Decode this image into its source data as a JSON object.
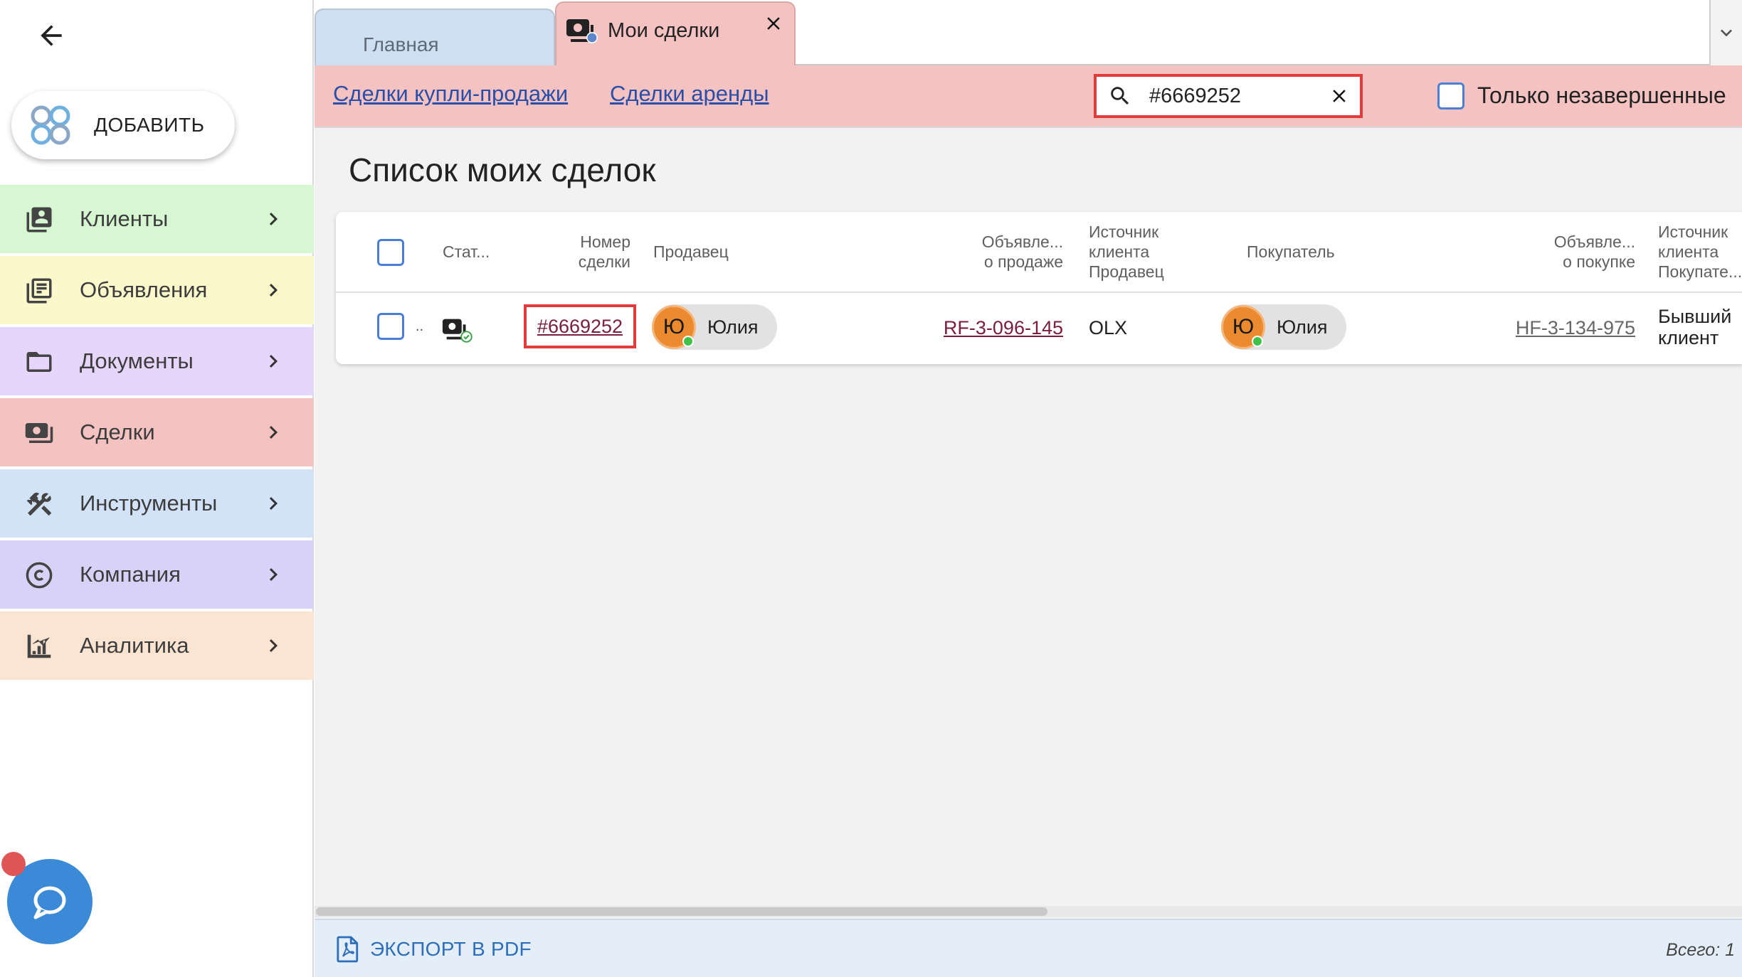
{
  "sidebar": {
    "add_label": "ДОБАВИТЬ",
    "items": [
      {
        "label": "Клиенты",
        "color": "#d6f7d2",
        "icon": "contacts-icon"
      },
      {
        "label": "Объявления",
        "color": "#fbf8cc",
        "icon": "listings-icon"
      },
      {
        "label": "Документы",
        "color": "#e6d6fb",
        "icon": "folder-icon"
      },
      {
        "label": "Сделки",
        "color": "#f5c2c2",
        "icon": "money-icon"
      },
      {
        "label": "Инструменты",
        "color": "#d2e2f7",
        "icon": "tools-icon"
      },
      {
        "label": "Компания",
        "color": "#d9d2f8",
        "icon": "copyright-icon"
      },
      {
        "label": "Аналитика",
        "color": "#fbe4d2",
        "icon": "analytics-icon"
      }
    ]
  },
  "tabs": [
    {
      "label": "Главная"
    },
    {
      "label": "Мои сделки"
    }
  ],
  "subnav": {
    "links": [
      "Сделки купли-продажи",
      "Сделки аренды"
    ],
    "search_value": "#6669252",
    "only_unfinished_label": "Только незавершенные"
  },
  "page_title": "Список моих сделок",
  "table": {
    "headers": {
      "status": "Стат...",
      "deal_number": [
        "Номер",
        "сделки"
      ],
      "seller": "Продавец",
      "sale_listing": [
        "Объявле...",
        "о продаже"
      ],
      "seller_source": [
        "Источник",
        "клиента",
        "Продавец"
      ],
      "buyer": "Покупатель",
      "buy_listing": [
        "Объявле...",
        "о покупке"
      ],
      "buyer_source": [
        "Источник",
        "клиента",
        "Покупате..."
      ]
    },
    "rows": [
      {
        "status_suffix": "..",
        "deal_number": "#6669252",
        "seller_initial": "Ю",
        "seller_name": "Юлия",
        "sale_listing": "RF-3-096-145",
        "seller_source": "OLX",
        "buyer_initial": "Ю",
        "buyer_name": "Юлия",
        "buy_listing": "HF-3-134-975",
        "buyer_source": [
          "Бывший",
          "клиент"
        ]
      }
    ]
  },
  "footer": {
    "export_label": "ЭКСПОРТ В PDF",
    "total": "Всего: 1"
  },
  "colors": {
    "accent_red": "#e23b3b",
    "deals_pink": "#f5c2c2",
    "link_blue": "#2a4fa8"
  }
}
